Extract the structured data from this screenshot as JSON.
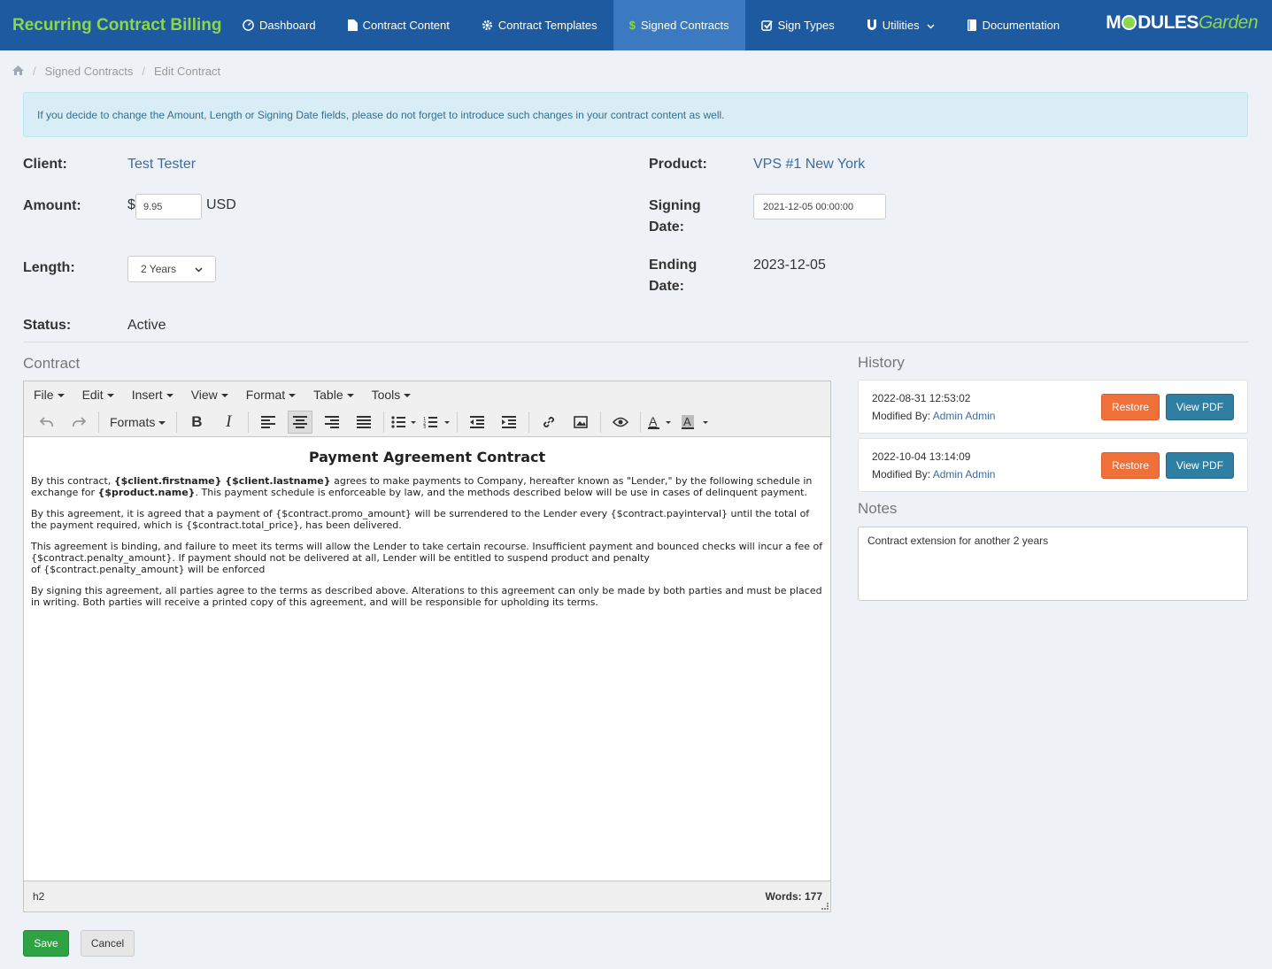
{
  "app": {
    "title": "Recurring Contract Billing",
    "logo_text_a": "M",
    "logo_text_b": "DULES",
    "logo_text_c": "Garden"
  },
  "nav": [
    {
      "label": "Dashboard",
      "icon": "dashboard-icon"
    },
    {
      "label": "Contract Content",
      "icon": "file-icon"
    },
    {
      "label": "Contract Templates",
      "icon": "gear-icon"
    },
    {
      "label": "Signed Contracts",
      "icon": "dollar-icon",
      "active": true
    },
    {
      "label": "Sign Types",
      "icon": "check-square-icon"
    },
    {
      "label": "Utilities",
      "icon": "magnet-icon"
    },
    {
      "label": "Documentation",
      "icon": "book-icon"
    }
  ],
  "breadcrumb": {
    "items": [
      "Signed Contracts",
      "Edit Contract"
    ]
  },
  "alert": "If you decide to change the Amount, Length or Signing Date fields, please do not forget to introduce such changes in your contract content as well.",
  "fields": {
    "client_label": "Client:",
    "client_value": "Test Tester",
    "product_label": "Product:",
    "product_value": "VPS #1 New York",
    "amount_label": "Amount:",
    "currency_symbol": "$",
    "amount_value": "9.95",
    "currency": "USD",
    "signing_label_1": "Signing",
    "signing_label_2": "Date:",
    "signing_value": "2021-12-05 00:00:00",
    "length_label": "Length:",
    "length_value": "2 Years",
    "ending_label_1": "Ending",
    "ending_label_2": "Date:",
    "ending_value": "2023-12-05",
    "status_label": "Status:",
    "status_value": "Active"
  },
  "contract": {
    "title": "Contract",
    "menus": [
      "File",
      "Edit",
      "Insert",
      "View",
      "Format",
      "Table",
      "Tools"
    ],
    "formats_label": "Formats",
    "heading": "Payment Agreement Contract",
    "p1_a": "By this contract, ",
    "p1_b": "{$client.firstname} {$client.lastname}",
    "p1_c": " agrees to make payments to Company, hereafter known as \"Lender,\" by the following schedule in exchange for ",
    "p1_d": "{$product.name}",
    "p1_e": ". This payment schedule is enforceable by law, and the methods described below will be use in cases of delinquent payment.",
    "p2": "By this agreement, it is agreed that a payment of {$contract.promo_amount} will be surrendered to the Lender every {$contract.payinterval} until the total of the payment required, which is {$contract.total_price}, has been delivered.",
    "p3_a": "This agreement is binding, and failure to meet its terms will allow the Lender to take certain recourse. Insufficient payment and bounced checks will incur a fee of {$contract.penalty_amount}. If payment should not be delivered at all, Lender will be entitled to suspend product and penalty",
    "p3_b": "of {$contract.penalty_amount} will be enforced",
    "p4": "By signing this agreement, all parties agree to the terms as described above. Alterations to this agreement can only be made by both parties and must be placed in writing. Both parties will receive a printed copy of this agreement, and will be responsible for upholding its terms.",
    "status_path": "h2",
    "word_count": "Words: 177"
  },
  "history": {
    "title": "History",
    "modified_by_label": "Modified By: ",
    "restore_label": "Restore",
    "pdf_label": "View PDF",
    "entries": [
      {
        "date": "2022-08-31 12:53:02",
        "user": "Admin Admin"
      },
      {
        "date": "2022-10-04 13:14:09",
        "user": "Admin Admin"
      }
    ]
  },
  "notes": {
    "title": "Notes",
    "value": "Contract extension for another 2 years"
  },
  "actions": {
    "save": "Save",
    "cancel": "Cancel"
  }
}
